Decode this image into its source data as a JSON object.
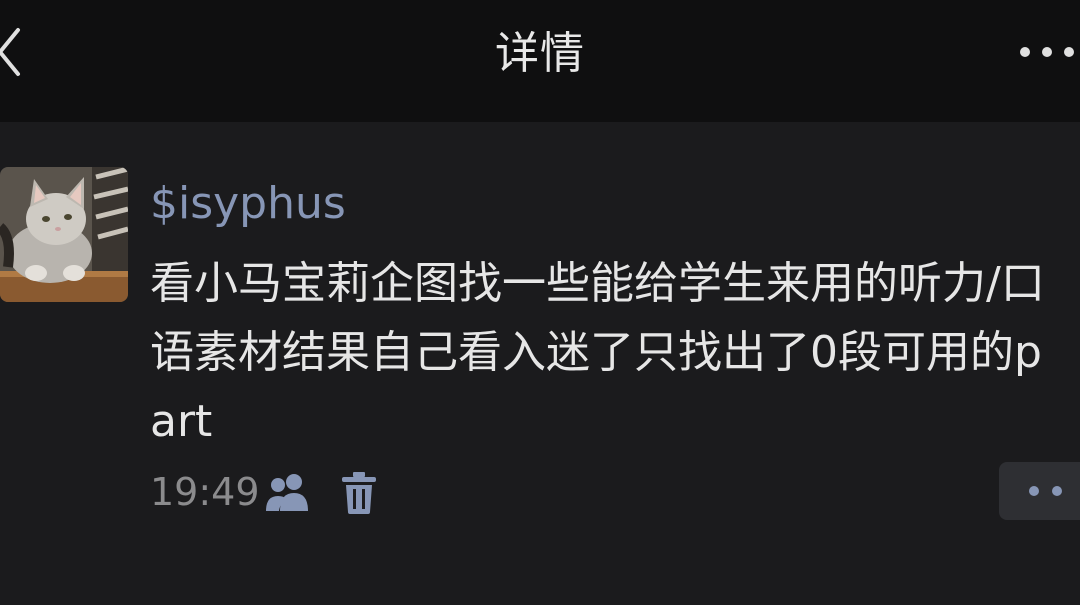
{
  "nav": {
    "title": "详情",
    "back_icon": "chevron-left-icon",
    "more_icon": "more-dots-icon"
  },
  "post": {
    "author": "$isyphus",
    "text": "看小马宝莉企图找一些能给学生来用的听力/口语素材结果自己看入迷了只找出了0段可用的part",
    "time": "19:49",
    "visibility_icon": "friends-icon",
    "delete_icon": "trash-icon",
    "action_icon": "comment-dots-icon"
  },
  "colors": {
    "nav_bg": "#0f0f10",
    "page_bg": "#1b1b1d",
    "author": "#8796b6",
    "text": "#e6e6e6",
    "meta": "#8b8b8d",
    "action_bg": "#2e2f33"
  }
}
